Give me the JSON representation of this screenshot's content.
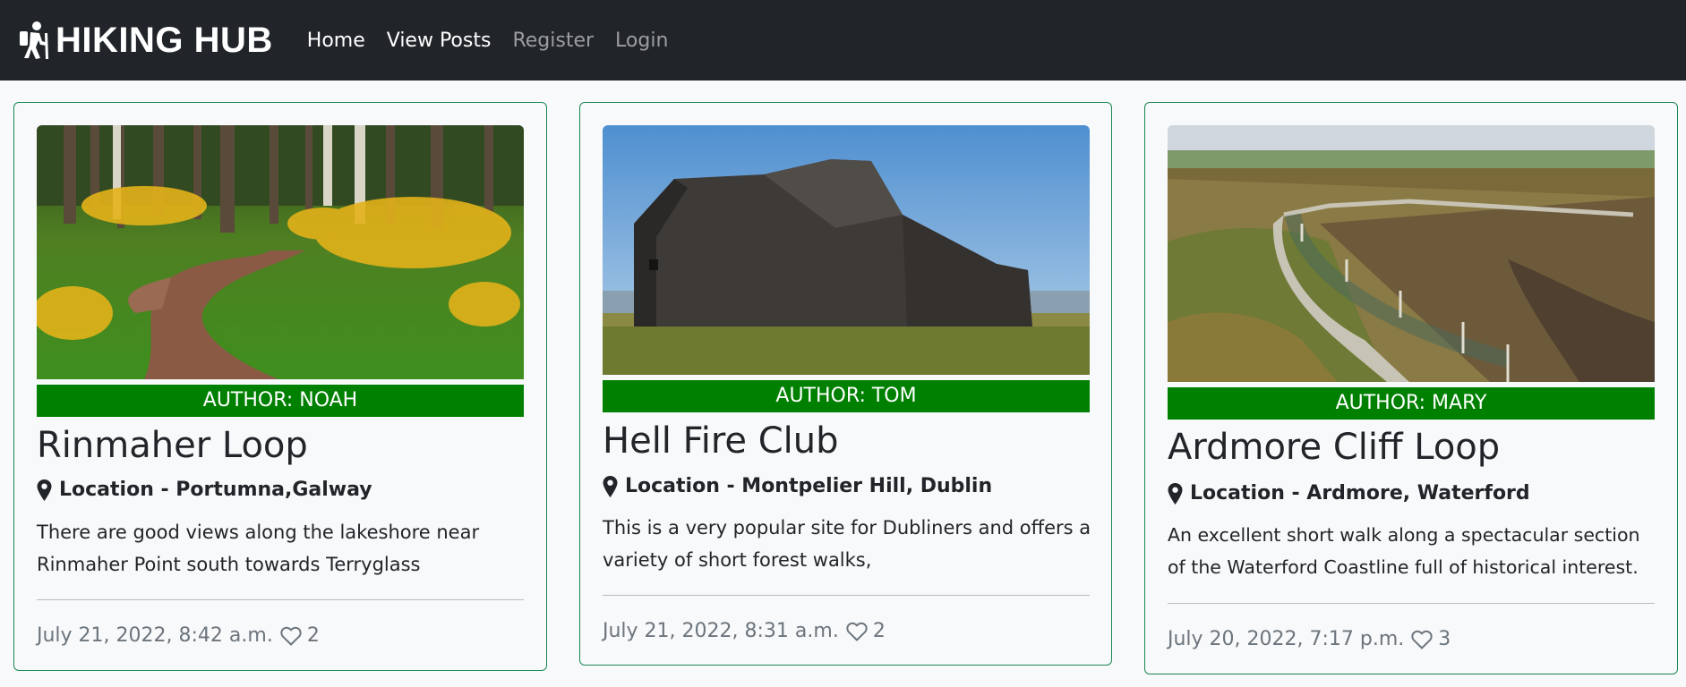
{
  "navbar": {
    "brand": "HIKING HUB",
    "brand_icon": "hiker-icon",
    "links": [
      {
        "label": "Home"
      },
      {
        "label": "View Posts"
      },
      {
        "label": "Register"
      },
      {
        "label": "Login"
      }
    ]
  },
  "colors": {
    "navbar_bg": "#212529",
    "card_border": "#198754",
    "author_badge": "#008000",
    "meta_text": "#6c757d"
  },
  "posts": [
    {
      "image": "forest-trail-photo",
      "author": "AUTHOR: NOAH",
      "title": "Rinmaher Loop",
      "location": "Location - Portumna,Galway",
      "excerpt": "There are good views along the lakeshore near Rinmaher Point south towards Terryglass",
      "date": "July 21, 2022, 8:42 a.m.",
      "likes": "2"
    },
    {
      "image": "stone-ruin-photo",
      "author": "AUTHOR: TOM",
      "title": "Hell Fire Club",
      "location": "Location - Montpelier Hill, Dublin",
      "excerpt": "This is a very popular site for Dubliners and offers a variety of short forest walks,",
      "date": "July 21, 2022, 8:31 a.m.",
      "likes": "2"
    },
    {
      "image": "cliff-path-photo",
      "author": "AUTHOR: MARY",
      "title": "Ardmore Cliff Loop",
      "location": "Location - Ardmore, Waterford",
      "excerpt": "An excellent short walk along a spectacular section of the Waterford Coastline full of historical interest.",
      "date": "July 20, 2022, 7:17 p.m.",
      "likes": "3"
    }
  ]
}
